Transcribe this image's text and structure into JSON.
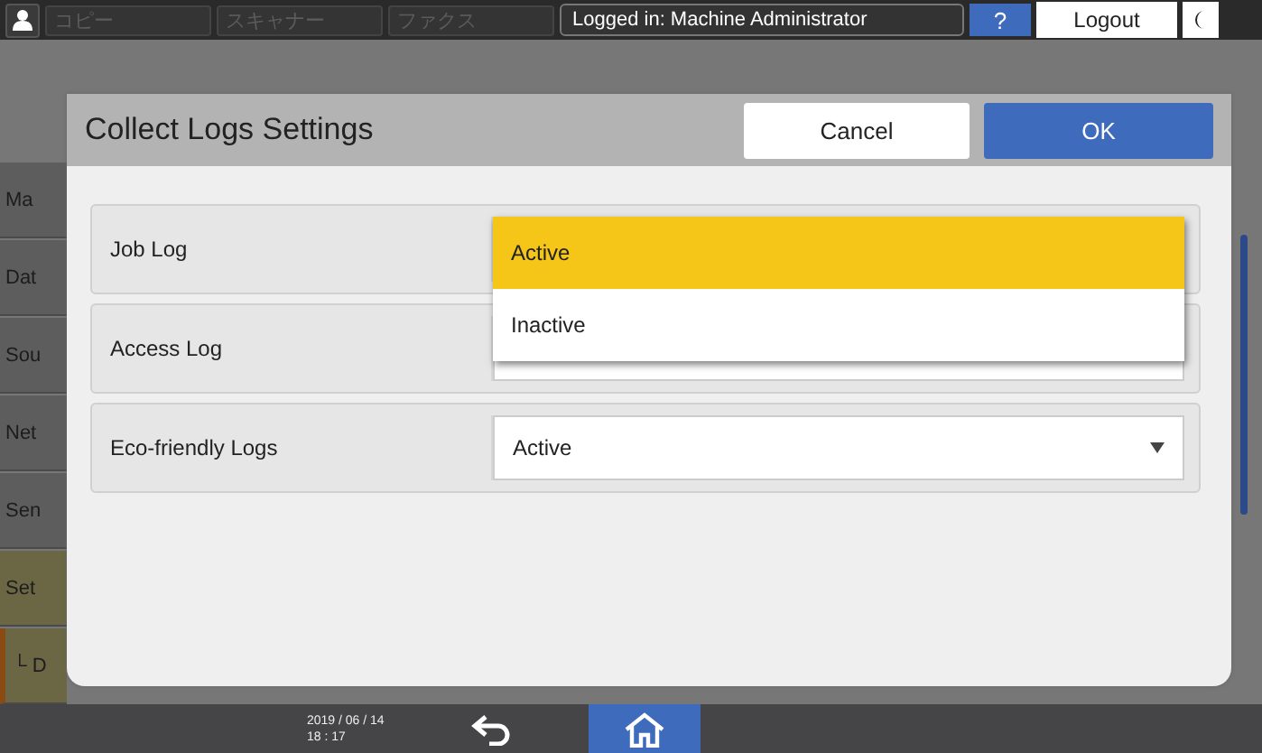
{
  "top_bar": {
    "tabs": [
      {
        "label": "コピー",
        "disabled": true
      },
      {
        "label": "スキャナー",
        "disabled": true
      },
      {
        "label": "ファクス",
        "disabled": true
      }
    ],
    "login_status": "Logged in: Machine Administrator",
    "help": "?",
    "logout": "Logout"
  },
  "sidebar": {
    "items": [
      {
        "label": "Ma",
        "kind": "item",
        "selected": false
      },
      {
        "label": "Dat",
        "kind": "item",
        "selected": false
      },
      {
        "label": "Sou",
        "kind": "item",
        "selected": false
      },
      {
        "label": "Net",
        "kind": "item",
        "selected": false
      },
      {
        "label": "Sen",
        "kind": "item",
        "selected": false
      },
      {
        "label": "Set",
        "kind": "item",
        "selected": true
      },
      {
        "label": "└ D",
        "kind": "subitem",
        "selected": true
      }
    ]
  },
  "dialog": {
    "title": "Collect Logs Settings",
    "cancel": "Cancel",
    "ok": "OK",
    "rows": [
      {
        "label": "Job Log",
        "options": [
          {
            "label": "Active",
            "selected": true
          },
          {
            "label": "Inactive",
            "selected": false
          }
        ]
      },
      {
        "label": "Access Log"
      },
      {
        "label": "Eco-friendly Logs",
        "value": "Active"
      }
    ]
  },
  "bottom_bar": {
    "date": "2019 / 06 / 14",
    "time": "18 : 17"
  }
}
